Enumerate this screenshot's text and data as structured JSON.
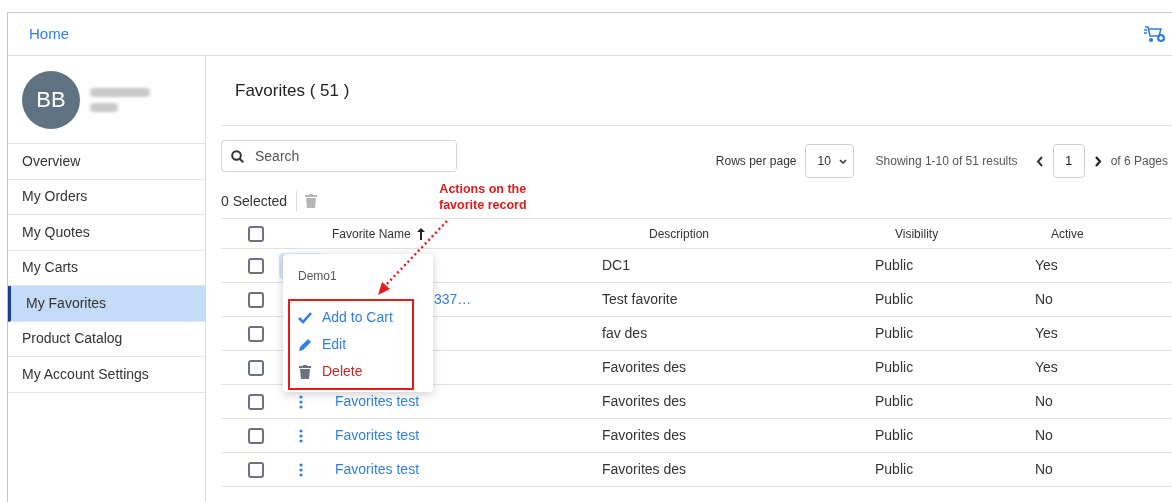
{
  "header": {
    "title": "Home"
  },
  "user": {
    "initials": "BB"
  },
  "sidebar": {
    "items": [
      {
        "label": "Overview",
        "selected": false
      },
      {
        "label": "My Orders",
        "selected": false
      },
      {
        "label": "My Quotes",
        "selected": false
      },
      {
        "label": "My Carts",
        "selected": false
      },
      {
        "label": "My Favorites",
        "selected": true
      },
      {
        "label": "Product Catalog",
        "selected": false
      },
      {
        "label": "My Account Settings",
        "selected": false
      }
    ]
  },
  "page_title": "Favorites ( 51 )",
  "search": {
    "placeholder": "Search"
  },
  "pagination": {
    "rows_label": "Rows per page",
    "rows_value": "10",
    "summary": "Showing 1-10 of 51 results",
    "page": "1",
    "of_pages": "of 6 Pages"
  },
  "selection": {
    "count": "0 Selected"
  },
  "table": {
    "header_checked": false,
    "columns": [
      {
        "label": "Favorite Name",
        "sorted": true
      },
      {
        "label": "Description",
        "sorted": false
      },
      {
        "label": "Visibility",
        "sorted": false
      },
      {
        "label": "Active",
        "sorted": false
      }
    ],
    "rows": [
      {
        "checked": false,
        "name": "",
        "description": "DC1",
        "visibility": "Public",
        "active": "Yes"
      },
      {
        "checked": false,
        "name": "337…",
        "description": "Test favorite",
        "visibility": "Public",
        "active": "No"
      },
      {
        "checked": false,
        "name": "",
        "description": "fav des",
        "visibility": "Public",
        "active": "Yes"
      },
      {
        "checked": false,
        "name": "",
        "description": "Favorites des",
        "visibility": "Public",
        "active": "Yes"
      },
      {
        "checked": false,
        "name": "Favorites test",
        "description": "Favorites des",
        "visibility": "Public",
        "active": "No"
      },
      {
        "checked": false,
        "name": "Favorites test",
        "description": "Favorites des",
        "visibility": "Public",
        "active": "No"
      },
      {
        "checked": false,
        "name": "Favorites test",
        "description": "Favorites des",
        "visibility": "Public",
        "active": "No"
      }
    ]
  },
  "row_menu": {
    "title": "Demo1",
    "items": [
      {
        "kind": "add",
        "label": "Add to Cart"
      },
      {
        "kind": "edit",
        "label": "Edit"
      },
      {
        "kind": "delete",
        "label": "Delete"
      }
    ]
  },
  "annotation": {
    "lines": [
      "Actions on the",
      "favorite record"
    ]
  }
}
